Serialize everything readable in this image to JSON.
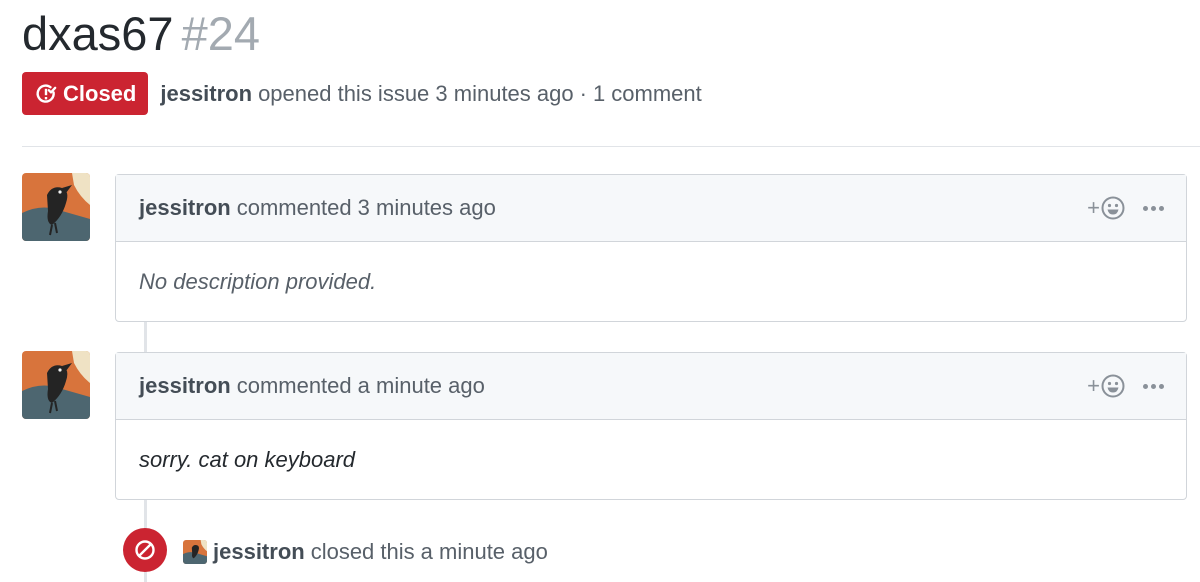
{
  "issue": {
    "title": "dxas67",
    "number": "#24",
    "state": "Closed",
    "state_icon": "issue-closed-icon",
    "state_color": "#cb2431",
    "author": "jessitron",
    "opened_text": "opened this issue 3 minutes ago",
    "separator": "·",
    "comment_count": "1 comment"
  },
  "comments": [
    {
      "author": "jessitron",
      "action": "commented",
      "time": "3 minutes ago",
      "body": "No description provided.",
      "reaction_icon": "add-reaction-icon",
      "more_icon": "kebab-horizontal-icon"
    },
    {
      "author": "jessitron",
      "action": "commented",
      "time": "a minute ago",
      "body": "sorry. cat on keyboard",
      "reaction_icon": "add-reaction-icon",
      "more_icon": "kebab-horizontal-icon"
    }
  ],
  "close_event": {
    "icon": "circle-slash-icon",
    "author": "jessitron",
    "action": "closed this",
    "time": "a minute ago"
  },
  "colors": {
    "closed": "#cb2431",
    "header_bg": "#f6f8fa",
    "border": "#d1d5da",
    "muted_text": "#586069",
    "number_text": "#a3aab1"
  }
}
